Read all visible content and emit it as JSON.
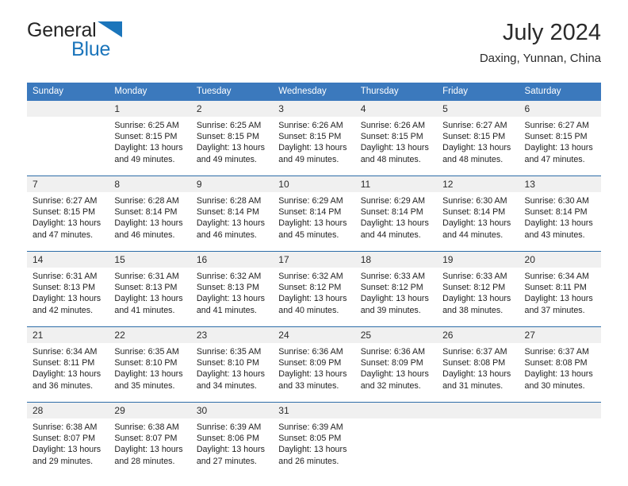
{
  "brand": {
    "word1": "General",
    "word2": "Blue",
    "triangle_color": "#1b75bb",
    "text_color": "#252525"
  },
  "header": {
    "title": "July 2024",
    "location": "Daxing, Yunnan, China"
  },
  "theme": {
    "header_row_bg": "#3b79bd",
    "header_row_text": "#ffffff",
    "daynum_bg": "#f0f0f0",
    "week_divider": "#2e6da8",
    "body_text": "#222222"
  },
  "weekday_headers": [
    "Sunday",
    "Monday",
    "Tuesday",
    "Wednesday",
    "Thursday",
    "Friday",
    "Saturday"
  ],
  "labels": {
    "sunrise_prefix": "Sunrise:",
    "sunset_prefix": "Sunset:",
    "daylight_prefix": "Daylight:"
  },
  "weeks": [
    [
      {
        "day": "",
        "lines": [
          "",
          "",
          "",
          ""
        ]
      },
      {
        "day": "1",
        "lines": [
          "Sunrise: 6:25 AM",
          "Sunset: 8:15 PM",
          "Daylight: 13 hours",
          "and 49 minutes."
        ]
      },
      {
        "day": "2",
        "lines": [
          "Sunrise: 6:25 AM",
          "Sunset: 8:15 PM",
          "Daylight: 13 hours",
          "and 49 minutes."
        ]
      },
      {
        "day": "3",
        "lines": [
          "Sunrise: 6:26 AM",
          "Sunset: 8:15 PM",
          "Daylight: 13 hours",
          "and 49 minutes."
        ]
      },
      {
        "day": "4",
        "lines": [
          "Sunrise: 6:26 AM",
          "Sunset: 8:15 PM",
          "Daylight: 13 hours",
          "and 48 minutes."
        ]
      },
      {
        "day": "5",
        "lines": [
          "Sunrise: 6:27 AM",
          "Sunset: 8:15 PM",
          "Daylight: 13 hours",
          "and 48 minutes."
        ]
      },
      {
        "day": "6",
        "lines": [
          "Sunrise: 6:27 AM",
          "Sunset: 8:15 PM",
          "Daylight: 13 hours",
          "and 47 minutes."
        ]
      }
    ],
    [
      {
        "day": "7",
        "lines": [
          "Sunrise: 6:27 AM",
          "Sunset: 8:15 PM",
          "Daylight: 13 hours",
          "and 47 minutes."
        ]
      },
      {
        "day": "8",
        "lines": [
          "Sunrise: 6:28 AM",
          "Sunset: 8:14 PM",
          "Daylight: 13 hours",
          "and 46 minutes."
        ]
      },
      {
        "day": "9",
        "lines": [
          "Sunrise: 6:28 AM",
          "Sunset: 8:14 PM",
          "Daylight: 13 hours",
          "and 46 minutes."
        ]
      },
      {
        "day": "10",
        "lines": [
          "Sunrise: 6:29 AM",
          "Sunset: 8:14 PM",
          "Daylight: 13 hours",
          "and 45 minutes."
        ]
      },
      {
        "day": "11",
        "lines": [
          "Sunrise: 6:29 AM",
          "Sunset: 8:14 PM",
          "Daylight: 13 hours",
          "and 44 minutes."
        ]
      },
      {
        "day": "12",
        "lines": [
          "Sunrise: 6:30 AM",
          "Sunset: 8:14 PM",
          "Daylight: 13 hours",
          "and 44 minutes."
        ]
      },
      {
        "day": "13",
        "lines": [
          "Sunrise: 6:30 AM",
          "Sunset: 8:14 PM",
          "Daylight: 13 hours",
          "and 43 minutes."
        ]
      }
    ],
    [
      {
        "day": "14",
        "lines": [
          "Sunrise: 6:31 AM",
          "Sunset: 8:13 PM",
          "Daylight: 13 hours",
          "and 42 minutes."
        ]
      },
      {
        "day": "15",
        "lines": [
          "Sunrise: 6:31 AM",
          "Sunset: 8:13 PM",
          "Daylight: 13 hours",
          "and 41 minutes."
        ]
      },
      {
        "day": "16",
        "lines": [
          "Sunrise: 6:32 AM",
          "Sunset: 8:13 PM",
          "Daylight: 13 hours",
          "and 41 minutes."
        ]
      },
      {
        "day": "17",
        "lines": [
          "Sunrise: 6:32 AM",
          "Sunset: 8:12 PM",
          "Daylight: 13 hours",
          "and 40 minutes."
        ]
      },
      {
        "day": "18",
        "lines": [
          "Sunrise: 6:33 AM",
          "Sunset: 8:12 PM",
          "Daylight: 13 hours",
          "and 39 minutes."
        ]
      },
      {
        "day": "19",
        "lines": [
          "Sunrise: 6:33 AM",
          "Sunset: 8:12 PM",
          "Daylight: 13 hours",
          "and 38 minutes."
        ]
      },
      {
        "day": "20",
        "lines": [
          "Sunrise: 6:34 AM",
          "Sunset: 8:11 PM",
          "Daylight: 13 hours",
          "and 37 minutes."
        ]
      }
    ],
    [
      {
        "day": "21",
        "lines": [
          "Sunrise: 6:34 AM",
          "Sunset: 8:11 PM",
          "Daylight: 13 hours",
          "and 36 minutes."
        ]
      },
      {
        "day": "22",
        "lines": [
          "Sunrise: 6:35 AM",
          "Sunset: 8:10 PM",
          "Daylight: 13 hours",
          "and 35 minutes."
        ]
      },
      {
        "day": "23",
        "lines": [
          "Sunrise: 6:35 AM",
          "Sunset: 8:10 PM",
          "Daylight: 13 hours",
          "and 34 minutes."
        ]
      },
      {
        "day": "24",
        "lines": [
          "Sunrise: 6:36 AM",
          "Sunset: 8:09 PM",
          "Daylight: 13 hours",
          "and 33 minutes."
        ]
      },
      {
        "day": "25",
        "lines": [
          "Sunrise: 6:36 AM",
          "Sunset: 8:09 PM",
          "Daylight: 13 hours",
          "and 32 minutes."
        ]
      },
      {
        "day": "26",
        "lines": [
          "Sunrise: 6:37 AM",
          "Sunset: 8:08 PM",
          "Daylight: 13 hours",
          "and 31 minutes."
        ]
      },
      {
        "day": "27",
        "lines": [
          "Sunrise: 6:37 AM",
          "Sunset: 8:08 PM",
          "Daylight: 13 hours",
          "and 30 minutes."
        ]
      }
    ],
    [
      {
        "day": "28",
        "lines": [
          "Sunrise: 6:38 AM",
          "Sunset: 8:07 PM",
          "Daylight: 13 hours",
          "and 29 minutes."
        ]
      },
      {
        "day": "29",
        "lines": [
          "Sunrise: 6:38 AM",
          "Sunset: 8:07 PM",
          "Daylight: 13 hours",
          "and 28 minutes."
        ]
      },
      {
        "day": "30",
        "lines": [
          "Sunrise: 6:39 AM",
          "Sunset: 8:06 PM",
          "Daylight: 13 hours",
          "and 27 minutes."
        ]
      },
      {
        "day": "31",
        "lines": [
          "Sunrise: 6:39 AM",
          "Sunset: 8:05 PM",
          "Daylight: 13 hours",
          "and 26 minutes."
        ]
      },
      {
        "day": "",
        "lines": [
          "",
          "",
          "",
          ""
        ]
      },
      {
        "day": "",
        "lines": [
          "",
          "",
          "",
          ""
        ]
      },
      {
        "day": "",
        "lines": [
          "",
          "",
          "",
          ""
        ]
      }
    ]
  ]
}
